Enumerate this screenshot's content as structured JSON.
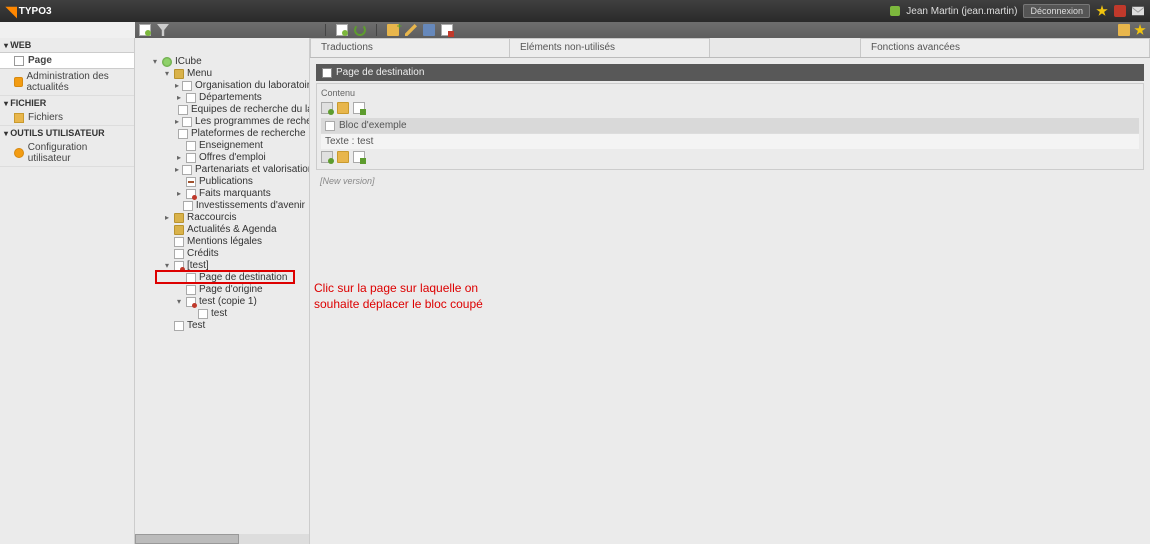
{
  "brand": "TYPO3",
  "user": {
    "display": "Jean Martin (jean.martin)",
    "logout": "Déconnexion"
  },
  "modules": {
    "web": {
      "head": "WEB",
      "items": [
        {
          "label": "Page",
          "icon": "page",
          "active": true
        },
        {
          "label": "Administration des actualités",
          "icon": "orange"
        }
      ]
    },
    "file": {
      "head": "FICHIER",
      "items": [
        {
          "label": "Fichiers",
          "icon": "folder"
        }
      ]
    },
    "usertools": {
      "head": "OUTILS UTILISATEUR",
      "items": [
        {
          "label": "Configuration utilisateur",
          "icon": "user"
        }
      ]
    }
  },
  "tree": [
    {
      "d": 0,
      "t": "▾",
      "i": "globe",
      "l": "ICube"
    },
    {
      "d": 1,
      "t": "▾",
      "i": "folder2",
      "l": "Menu"
    },
    {
      "d": 2,
      "t": "▸",
      "i": "page2",
      "l": "Organisation du laboratoire ICube"
    },
    {
      "d": 2,
      "t": "▸",
      "i": "page2",
      "l": "Départements"
    },
    {
      "d": 2,
      "t": "",
      "i": "page2",
      "l": "Equipes de recherche du laboratoire ICube"
    },
    {
      "d": 2,
      "t": "▸",
      "i": "page2",
      "l": "Les programmes de recherche transversaux"
    },
    {
      "d": 2,
      "t": "",
      "i": "page2",
      "l": "Plateformes de recherche"
    },
    {
      "d": 2,
      "t": "",
      "i": "page2",
      "l": "Enseignement"
    },
    {
      "d": 2,
      "t": "▸",
      "i": "page2",
      "l": "Offres d'emploi"
    },
    {
      "d": 2,
      "t": "▸",
      "i": "page2",
      "l": "Partenariats et valorisation"
    },
    {
      "d": 2,
      "t": "",
      "i": "shortcut",
      "l": "Publications"
    },
    {
      "d": 2,
      "t": "▸",
      "i": "page-hid",
      "l": "Faits marquants"
    },
    {
      "d": 2,
      "t": "",
      "i": "page2",
      "l": "Investissements d'avenir"
    },
    {
      "d": 1,
      "t": "▸",
      "i": "folder2",
      "l": "Raccourcis"
    },
    {
      "d": 1,
      "t": "",
      "i": "folder2",
      "l": "Actualités & Agenda"
    },
    {
      "d": 1,
      "t": "",
      "i": "page2",
      "l": "Mentions légales"
    },
    {
      "d": 1,
      "t": "",
      "i": "page2",
      "l": "Crédits"
    },
    {
      "d": 1,
      "t": "▾",
      "i": "page-hid",
      "l": "[test]"
    },
    {
      "d": 2,
      "t": "",
      "i": "page2",
      "l": "Page de destination",
      "hl": true
    },
    {
      "d": 2,
      "t": "",
      "i": "page2",
      "l": "Page d'origine"
    },
    {
      "d": 2,
      "t": "▾",
      "i": "page-hid",
      "l": "test (copie 1)"
    },
    {
      "d": 3,
      "t": "",
      "i": "page2",
      "l": "test"
    },
    {
      "d": 1,
      "t": "",
      "i": "page2",
      "l": "Test"
    }
  ],
  "tabs": [
    "Traductions",
    "Eléments non-utilisés",
    "Fonctions avancées"
  ],
  "page_header": "Page de destination",
  "content": {
    "section_label": "Contenu",
    "block_title": "Bloc d'exemple",
    "block_text_label": "Texte :",
    "block_text_value": "test",
    "new_version": "[New version]"
  },
  "annotation": "Clic sur la page sur laquelle on souhaite déplacer le bloc coupé"
}
